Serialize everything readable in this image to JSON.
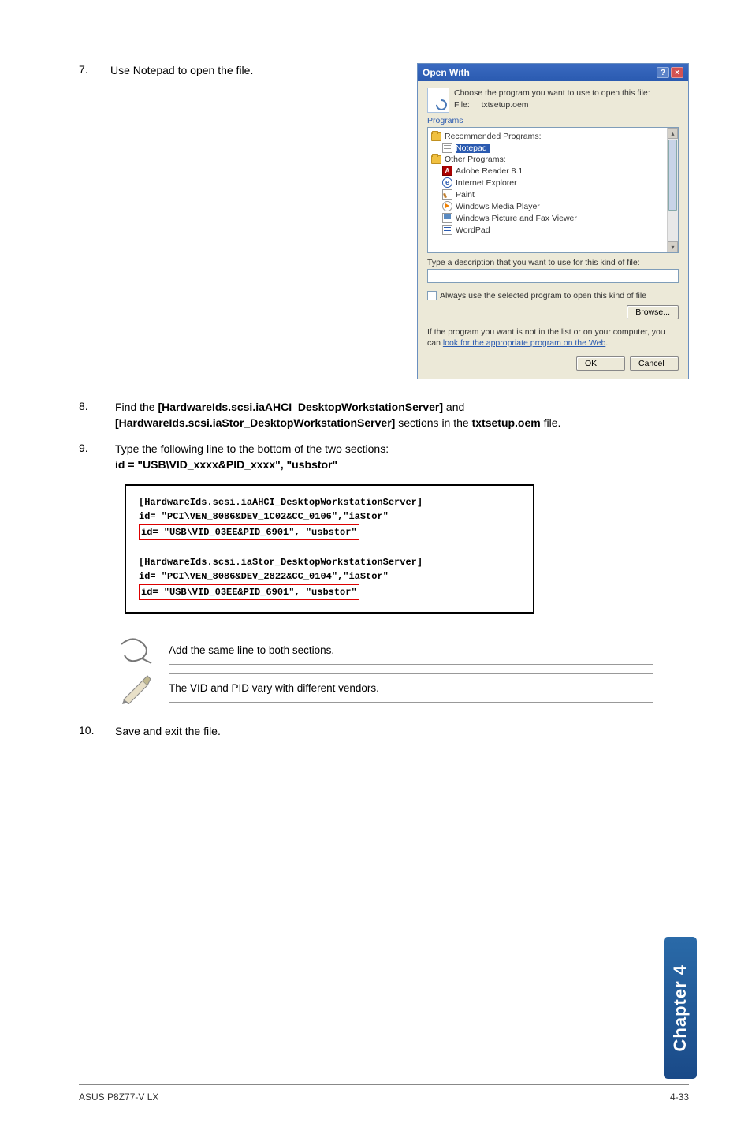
{
  "step7": {
    "num": "7.",
    "text": "Use Notepad to open the file."
  },
  "dialog": {
    "title": "Open With",
    "head1": "Choose the program you want to use to open this file:",
    "head2_label": "File:",
    "head2_value": "txtsetup.oem",
    "programs_label": "Programs",
    "groups": {
      "recommended": "Recommended Programs:",
      "other": "Other Programs:"
    },
    "items": {
      "notepad": "Notepad",
      "adobe": "Adobe Reader 8.1",
      "ie": "Internet Explorer",
      "paint": "Paint",
      "wmp": "Windows Media Player",
      "fax": "Windows Picture and Fax Viewer",
      "wordpad": "WordPad"
    },
    "desc_label": "Type a description that you want to use for this kind of file:",
    "chk_label": "Always use the selected program to open this kind of file",
    "browse": "Browse...",
    "link_pre": "If the program you want is not in the list or on your computer, you can ",
    "link_a": "look for the appropriate program on the Web",
    "link_post": ".",
    "ok": "OK",
    "cancel": "Cancel"
  },
  "step8": {
    "num": "8.",
    "pre": "Find the ",
    "b1": "[HardwareIds.scsi.iaAHCI_DesktopWorkstationServer]",
    "mid1": " and ",
    "b2": "[HardwareIds.scsi.iaStor_DesktopWorkstationServer]",
    "mid2": " sections in the ",
    "b3": "txtsetup.oem",
    "post": " file."
  },
  "step9": {
    "num": "9.",
    "l1": "Type the following line to the bottom of the two sections:",
    "l2": "id = \"USB\\VID_xxxx&PID_xxxx\", \"usbstor\""
  },
  "code": {
    "a1": "[HardwareIds.scsi.iaAHCI_DesktopWorkstationServer]",
    "a2": "id= \"PCI\\VEN_8086&DEV_1C02&CC_0106\",\"iaStor\"",
    "a3": "id= \"USB\\VID_03EE&PID_6901\", \"usbstor\"",
    "b1": "[HardwareIds.scsi.iaStor_DesktopWorkstationServer]",
    "b2": "id= \"PCI\\VEN_8086&DEV_2822&CC_0104\",\"iaStor\"",
    "b3": "id= \"USB\\VID_03EE&PID_6901\", \"usbstor\""
  },
  "note1": "Add the same line to both sections.",
  "note2": "The VID and PID vary with different vendors.",
  "step10": {
    "num": "10.",
    "text": "Save and exit the file."
  },
  "sidetab": "Chapter 4",
  "footer": {
    "left": "ASUS P8Z77-V LX",
    "right": "4-33"
  }
}
